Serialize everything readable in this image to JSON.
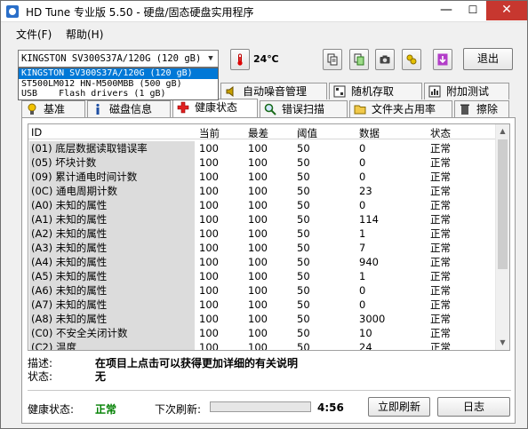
{
  "window": {
    "title": "HD Tune 专业版 5.50 - 硬盘/固态硬盘实用程序",
    "min": "—",
    "max": "☐",
    "close": "✕"
  },
  "menu": {
    "file": "文件(F)",
    "help": "帮助(H)"
  },
  "drive": {
    "selected": "KINGSTON SV300S37A/120G (120 gB)",
    "options": [
      "KINGSTON SV300S37A/120G (120 gB)",
      "ST500LM012 HN-M500MBB (500 gB)",
      "USB    Flash drivers (1 gB)"
    ]
  },
  "temperature": "24℃",
  "exit_label": "退出",
  "tabs_top": [
    {
      "label": "自动噪音管理",
      "icon": "speaker-icon"
    },
    {
      "label": "随机存取",
      "icon": "random-access-icon"
    },
    {
      "label": "附加测试",
      "icon": "extra-tests-icon"
    }
  ],
  "tabs_bottom": [
    {
      "label": "基准",
      "icon": "benchmark-icon"
    },
    {
      "label": "磁盘信息",
      "icon": "info-icon"
    },
    {
      "label": "健康状态",
      "icon": "health-cross-icon"
    },
    {
      "label": "错误扫描",
      "icon": "magnifier-icon"
    },
    {
      "label": "文件夹占用率",
      "icon": "folder-icon"
    },
    {
      "label": "擦除",
      "icon": "trash-icon"
    }
  ],
  "table": {
    "headers": [
      "ID",
      "当前",
      "最差",
      "阈值",
      "数据",
      "状态"
    ],
    "rows": [
      [
        "(01) 底层数据读取错误率",
        "100",
        "100",
        "50",
        "0",
        "正常"
      ],
      [
        "(05) 坏块计数",
        "100",
        "100",
        "50",
        "0",
        "正常"
      ],
      [
        "(09) 累计通电时间计数",
        "100",
        "100",
        "50",
        "0",
        "正常"
      ],
      [
        "(0C) 通电周期计数",
        "100",
        "100",
        "50",
        "23",
        "正常"
      ],
      [
        "(A0) 未知的属性",
        "100",
        "100",
        "50",
        "0",
        "正常"
      ],
      [
        "(A1) 未知的属性",
        "100",
        "100",
        "50",
        "114",
        "正常"
      ],
      [
        "(A2) 未知的属性",
        "100",
        "100",
        "50",
        "1",
        "正常"
      ],
      [
        "(A3) 未知的属性",
        "100",
        "100",
        "50",
        "7",
        "正常"
      ],
      [
        "(A4) 未知的属性",
        "100",
        "100",
        "50",
        "940",
        "正常"
      ],
      [
        "(A5) 未知的属性",
        "100",
        "100",
        "50",
        "1",
        "正常"
      ],
      [
        "(A6) 未知的属性",
        "100",
        "100",
        "50",
        "0",
        "正常"
      ],
      [
        "(A7) 未知的属性",
        "100",
        "100",
        "50",
        "0",
        "正常"
      ],
      [
        "(A8) 未知的属性",
        "100",
        "100",
        "50",
        "3000",
        "正常"
      ],
      [
        "(C0) 不安全关闭计数",
        "100",
        "100",
        "50",
        "10",
        "正常"
      ],
      [
        "(C2) 温度",
        "100",
        "100",
        "50",
        "24",
        "正常"
      ]
    ]
  },
  "details": {
    "desc_label": "描述:",
    "desc_value": "在项目上点击可以获得更加详细的有关说明",
    "status_label": "状态:",
    "status_value": "无"
  },
  "footer": {
    "health_label": "健康状态:",
    "health_value": "正常",
    "next_refresh_label": "下次刷新:",
    "countdown": "4:56",
    "refresh_button": "立即刷新",
    "log_button": "日志"
  },
  "colors": {
    "health_ok": "#008000",
    "selection": "#0078d7",
    "close": "#c7372f"
  }
}
